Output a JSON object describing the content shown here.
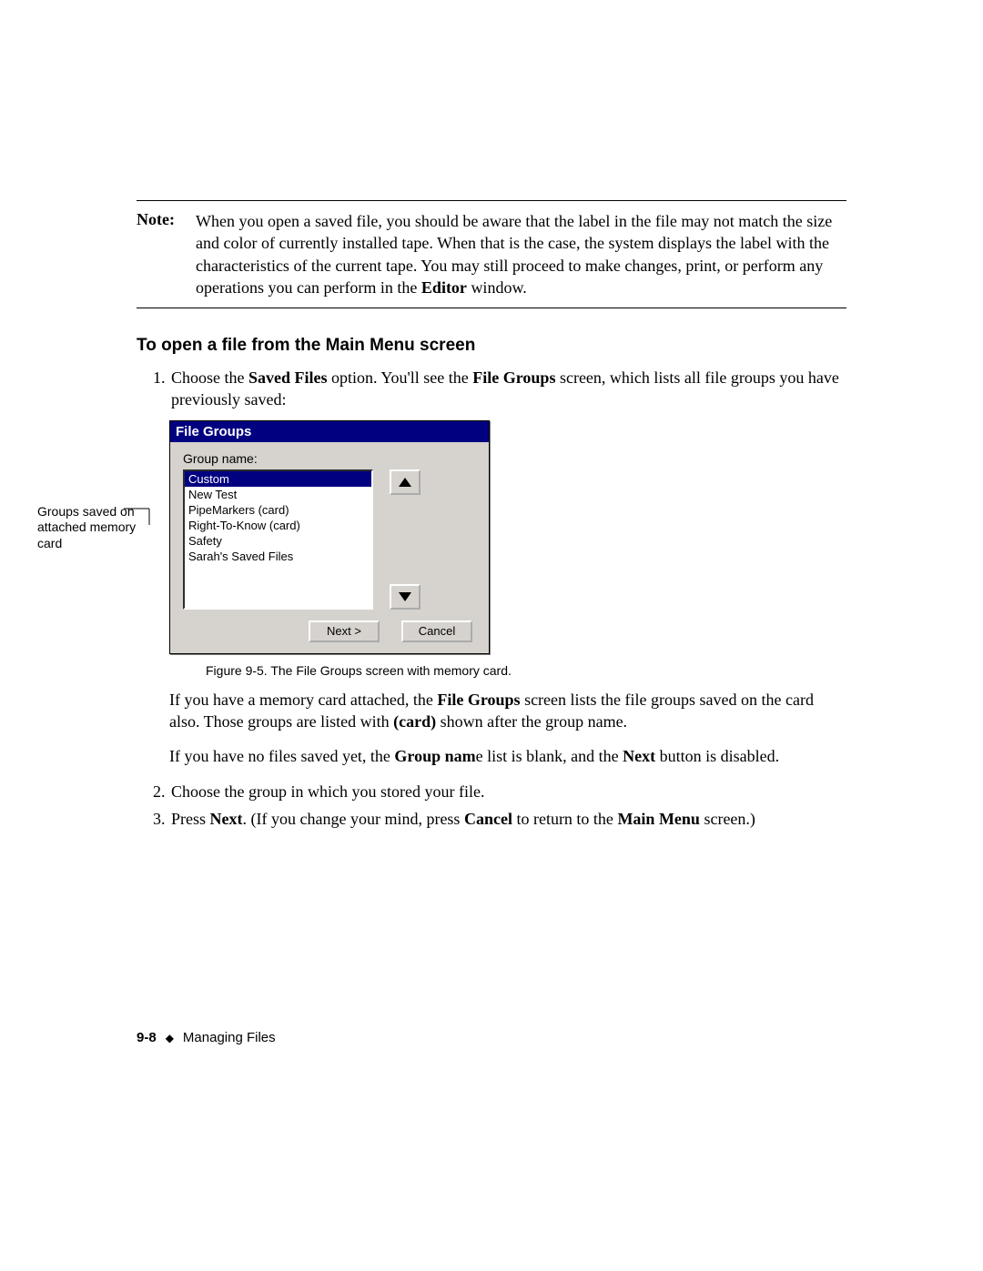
{
  "note": {
    "label": "Note:",
    "text_before": "When you open a saved file, you should be aware that the label in the file may not match the size and color of currently installed tape. When that is the case, the system displays the label with the characteristics of the current tape. You may still proceed to make changes, print, or perform any operations you can perform in the ",
    "bold1": "Editor",
    "text_after": " window."
  },
  "heading": "To open a file from the Main Menu screen",
  "step1": {
    "t1": "Choose the ",
    "b1": "Saved Files",
    "t2": " option. You'll see the ",
    "b2": "File Groups",
    "t3": " screen, which lists all file groups you have previously saved:"
  },
  "callout": "Groups saved on attached memory card",
  "dialog": {
    "title": "File Groups",
    "group_label": "Group name:",
    "items": [
      "Custom",
      "New Test",
      "PipeMarkers (card)",
      "Right-To-Know (card)",
      "Safety",
      "Sarah's Saved Files"
    ],
    "selected_index": 0,
    "next_label": "Next >",
    "cancel_label": "Cancel"
  },
  "caption": "Figure 9-5. The File Groups screen with memory card.",
  "para1": {
    "t1": "If you have a memory card attached, the ",
    "b1": "File Groups",
    "t2": " screen lists the file groups saved on the card also. Those groups are listed with ",
    "b2": "(card)",
    "t3": " shown after the group name."
  },
  "para2": {
    "t1": "If you have no files saved yet, the ",
    "b1": "Group nam",
    "t2": "e list is blank, and the ",
    "b2": "Next",
    "t3": " button is disabled."
  },
  "step2": "Choose the group in which you stored your file.",
  "step3": {
    "t1": "Press ",
    "b1": "Next",
    "t2": ". (If you change your mind, press ",
    "b2": "Cancel",
    "t3": " to return to the ",
    "b3": "Main Menu",
    "t4": " screen.)"
  },
  "footer": {
    "page": "9-8",
    "section": "Managing Files"
  }
}
